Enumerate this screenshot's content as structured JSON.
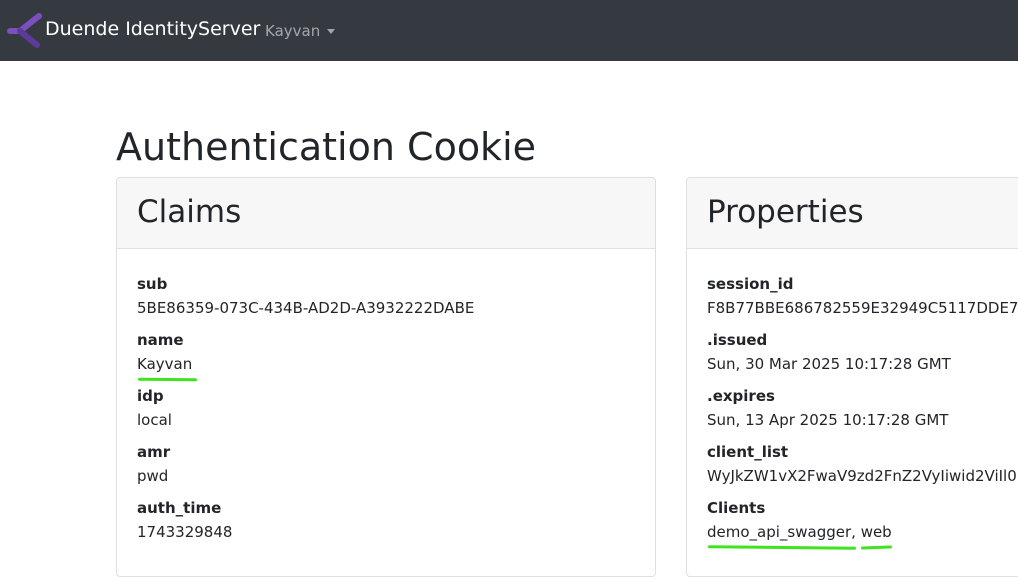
{
  "navbar": {
    "brand": "Duende IdentityServer",
    "user_menu": "Kayvan",
    "colors": {
      "background": "#343a40",
      "logo": "#7b4fbf"
    }
  },
  "page": {
    "title": "Authentication Cookie"
  },
  "claims": {
    "header": "Claims",
    "items": [
      {
        "name": "sub",
        "value": "5BE86359-073C-434B-AD2D-A3932222DABE"
      },
      {
        "name": "name",
        "value": "Kayvan"
      },
      {
        "name": "idp",
        "value": "local"
      },
      {
        "name": "amr",
        "value": "pwd"
      },
      {
        "name": "auth_time",
        "value": "1743329848"
      }
    ]
  },
  "properties": {
    "header": "Properties",
    "items": [
      {
        "name": "session_id",
        "value": "F8B77BBE686782559E32949C5117DDE7"
      },
      {
        "name": ".issued",
        "value": "Sun, 30 Mar 2025 10:17:28 GMT"
      },
      {
        "name": ".expires",
        "value": "Sun, 13 Apr 2025 10:17:28 GMT"
      },
      {
        "name": "client_list",
        "value": "WyJkZW1vX2FwaV9zd2FnZ2VyIiwid2ViIl0"
      },
      {
        "name": "Clients",
        "clients": [
          "demo_api_swagger",
          "web"
        ],
        "separator": ", "
      }
    ]
  },
  "annotation_color": "#3ee51f"
}
